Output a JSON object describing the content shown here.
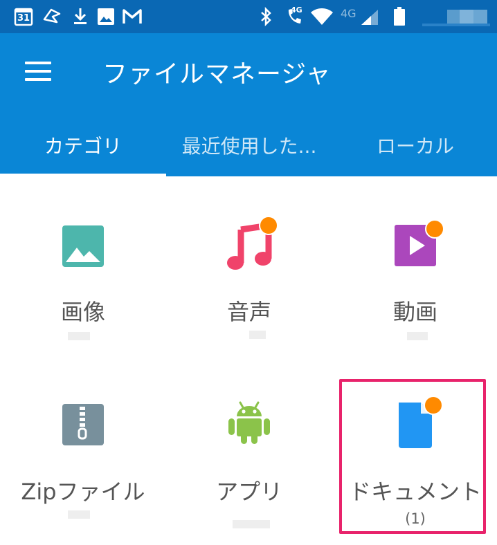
{
  "status_bar": {
    "calendar_day": "31",
    "network_label_1": "4G",
    "network_label_2": "4G",
    "icons": [
      "calendar-icon",
      "cast-icon",
      "download-icon",
      "image-icon",
      "gmail-icon",
      "bluetooth-icon",
      "wifi-calling-icon",
      "wifi-icon",
      "signal-icon",
      "battery-icon"
    ]
  },
  "app_bar": {
    "title": "ファイルマネージャ",
    "menu_icon": "hamburger-menu-icon"
  },
  "tabs": [
    {
      "label": "カテゴリ",
      "active": true
    },
    {
      "label": "最近使用した...",
      "active": false
    },
    {
      "label": "ローカル",
      "active": false
    }
  ],
  "categories": [
    {
      "label": "画像",
      "icon": "image-icon",
      "color": "#4db6ac",
      "badge": false
    },
    {
      "label": "音声",
      "icon": "music-note-icon",
      "color": "#f0436a",
      "badge": true
    },
    {
      "label": "動画",
      "icon": "video-play-icon",
      "color": "#ab47bc",
      "badge": true
    },
    {
      "label": "Zipファイル",
      "icon": "zip-archive-icon",
      "color": "#78909c",
      "badge": false
    },
    {
      "label": "アプリ",
      "icon": "android-icon",
      "color": "#8bc34a",
      "badge": false
    },
    {
      "label": "ドキュメント",
      "icon": "document-icon",
      "color": "#2196f3",
      "badge": true,
      "count": "(1)"
    }
  ],
  "colors": {
    "status_bar": "#0a68b4",
    "app_bar": "#0a86d6",
    "badge": "#ff8a00",
    "highlight": "#e8236b"
  }
}
